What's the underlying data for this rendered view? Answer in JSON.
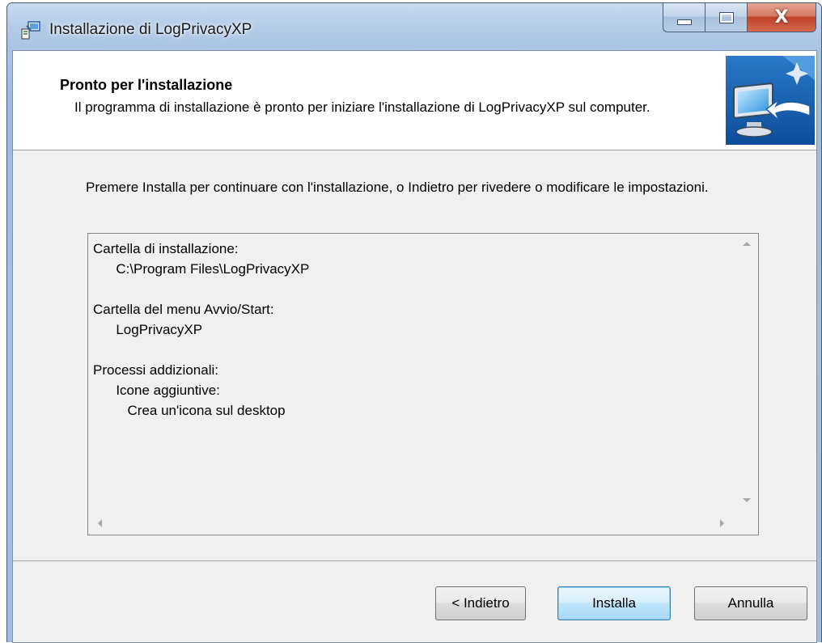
{
  "window": {
    "title": "Installazione di LogPrivacyXP",
    "app_icon": "installer-icon",
    "controls": {
      "minimize_icon": "minimize-icon",
      "maximize_icon": "maximize-icon",
      "close_label": "X"
    },
    "accent_close": "#c2432a"
  },
  "header": {
    "title": "Pronto per l'installazione",
    "description": "Il programma di installazione è pronto per iniziare l'installazione di LogPrivacyXP sul computer.",
    "image": "computer-monitor-arrow-icon"
  },
  "body": {
    "instruction": "Premere Installa per continuare con l'installazione, o Indietro per rivedere o modificare le impostazioni."
  },
  "summary": {
    "lines": [
      "Cartella di installazione:",
      "      C:\\Program Files\\LogPrivacyXP",
      "",
      "Cartella del menu Avvio/Start:",
      "      LogPrivacyXP",
      "",
      "Processi addizionali:",
      "      Icone aggiuntive:",
      "         Crea un'icona sul desktop"
    ]
  },
  "buttons": {
    "back": "< Indietro",
    "install": "Installa",
    "cancel": "Annulla"
  }
}
